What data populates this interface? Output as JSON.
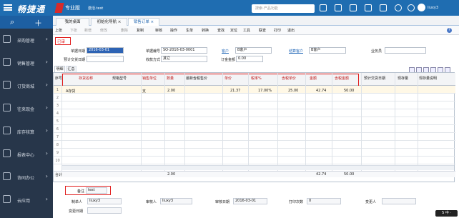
{
  "app": {
    "logo_text": "畅捷通",
    "edition": "专业版",
    "tenant_name": "激活.test",
    "search_placeholder": "搜索-产品功能",
    "user_name": "liuxy3",
    "top_icons": [
      "search-icon",
      "grid-icon",
      "bell-icon",
      "mail-icon",
      "phone-icon",
      "gear-icon",
      "help-icon"
    ]
  },
  "sidebar": {
    "items": [
      {
        "label": "采购管理",
        "icon": "cart-icon"
      },
      {
        "label": "销售管理",
        "icon": "chart-icon"
      },
      {
        "label": "订货商城",
        "icon": "store-icon"
      },
      {
        "label": "往来现金",
        "icon": "money-icon"
      },
      {
        "label": "库存核算",
        "icon": "box-icon"
      },
      {
        "label": "报表中心",
        "icon": "report-icon"
      },
      {
        "label": "协同办公",
        "icon": "office-icon"
      },
      {
        "label": "云应用",
        "icon": "cloud-icon"
      }
    ]
  },
  "tabs": [
    {
      "label": "我的桌面"
    },
    {
      "label": "初始化导航 ×"
    },
    {
      "label": "销售订单 ×"
    }
  ],
  "menu": [
    "上张",
    "下张",
    "新增",
    "修改",
    "删除",
    "复制",
    "审核",
    "操作",
    "生单",
    "转换",
    "查找",
    "定位",
    "工具",
    "联查",
    "打印",
    "退出"
  ],
  "status_badge": "已审",
  "form": {
    "date_label": "单据日期",
    "date_value": "2016-03-01",
    "doc_no_label": "单据编号",
    "doc_no_value": "SO-2016-03-0001",
    "customer_label": "客户",
    "customer_value": "B客户",
    "settle_customer_label": "结算客户",
    "settle_customer_value": "B客户",
    "salesman_label": "业务员",
    "delivery_date_label": "预计交货日期",
    "payment_method_label": "收款方式",
    "payment_method_value": "其它",
    "deposit_label": "订金金额",
    "deposit_value": "0.00"
  },
  "detail_tabs": [
    "明细",
    "汇总"
  ],
  "table": {
    "columns": [
      "序号",
      "存货名称",
      "规格型号",
      "销售单位",
      "数量",
      "最新含税售价",
      "单价",
      "税率%",
      "含税单价",
      "金额",
      "含税金额",
      "预计交货日期",
      "现存量",
      "现存量说明"
    ],
    "rows": [
      [
        "1",
        "A存货",
        "",
        "支",
        "2.00",
        "",
        "21.37",
        "17.00%",
        "25.00",
        "42.74",
        "50.00",
        "",
        "",
        ""
      ]
    ],
    "empty_rows": [
      "2",
      "3",
      "4",
      "5",
      "6",
      "7",
      "8",
      "9",
      "10"
    ],
    "total_label": "合计",
    "total_qty": "2.00",
    "total_amount": "42.74",
    "total_tax_amount": "50.00"
  },
  "footer": {
    "note_label": "备注",
    "note_value": "test",
    "maker_label": "制单人",
    "maker_value": "liuxy3",
    "approver_label": "审核人",
    "approver_value": "liuxy3",
    "audit_date_label": "审核日期",
    "audit_date_value": "2016-03-01",
    "print_count_label": "打印次数",
    "print_count_value": "0",
    "changer_label": "变更人",
    "change_date_label": "变更日期"
  }
}
